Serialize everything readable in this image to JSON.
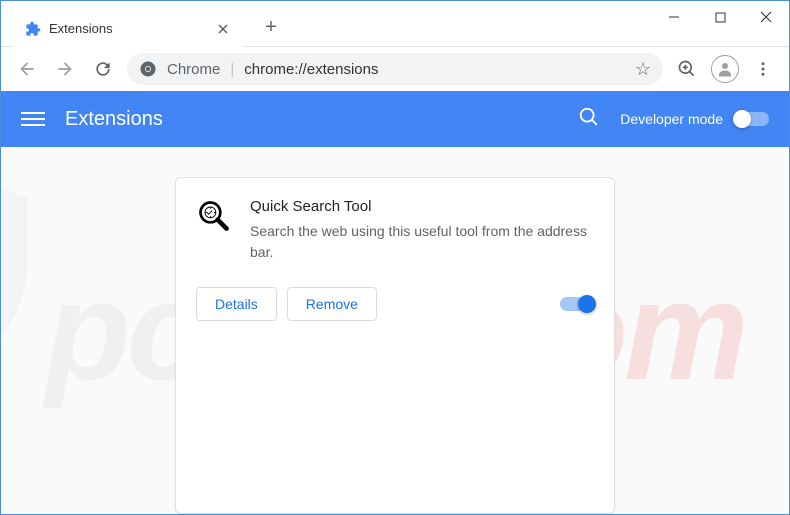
{
  "window": {
    "tab_title": "Extensions"
  },
  "omnibox": {
    "prefix": "Chrome",
    "url": "chrome://extensions"
  },
  "header": {
    "title": "Extensions",
    "dev_mode_label": "Developer mode",
    "dev_mode_enabled": false
  },
  "extension": {
    "name": "Quick Search Tool",
    "description": "Search the web using this useful tool from the address bar.",
    "details_label": "Details",
    "remove_label": "Remove",
    "enabled": true
  },
  "watermark": {
    "prefix": "pc",
    "suffix": "risk.com"
  }
}
